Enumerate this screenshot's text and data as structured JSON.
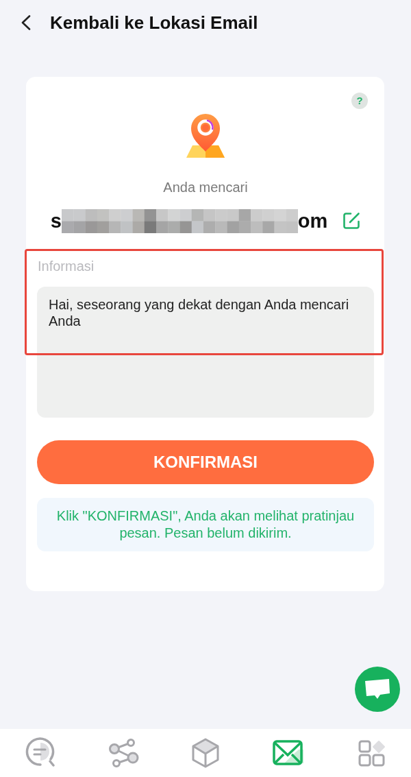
{
  "header": {
    "title": "Kembali ke Lokasi Email"
  },
  "card": {
    "help_button": "?",
    "subtitle": "Anda mencari",
    "email": {
      "prefix": "s",
      "suffix": "om"
    },
    "info": {
      "label": "Informasi",
      "value": "Hai, seseorang yang dekat dengan Anda mencari Anda",
      "highlighted": true
    },
    "confirm_button": "KONFIRMASI",
    "note": "Klik \"KONFIRMASI\", Anda akan melihat pratinjau pesan. Pesan belum dikirim."
  },
  "nav": [
    {
      "kind": "search",
      "selected": false
    },
    {
      "kind": "share",
      "selected": false
    },
    {
      "kind": "cube",
      "selected": false
    },
    {
      "kind": "mail",
      "selected": true
    },
    {
      "kind": "apps",
      "selected": false
    }
  ]
}
